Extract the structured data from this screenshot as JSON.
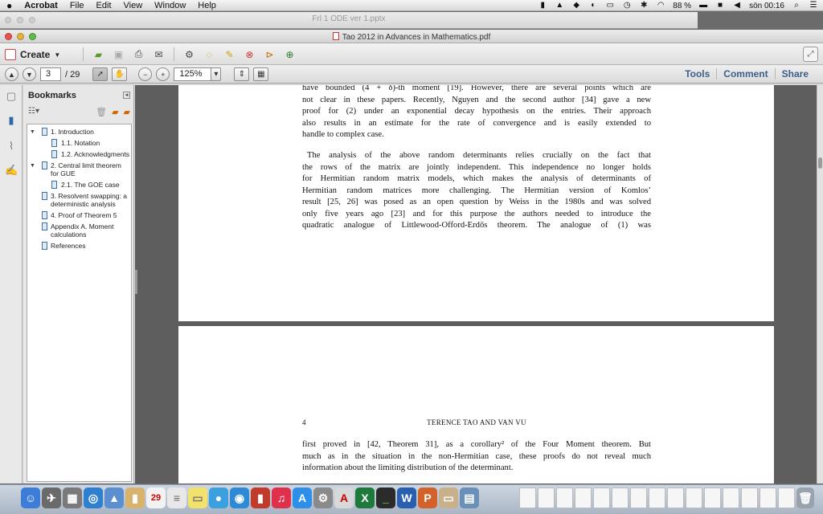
{
  "menubar": {
    "apple": "",
    "app": "Acrobat",
    "items": [
      "File",
      "Edit",
      "View",
      "Window",
      "Help"
    ],
    "battery": "88 %",
    "clock": "sön 00:16"
  },
  "background_window": {
    "title": "Frl 1 ODE ver 1.pptx"
  },
  "window": {
    "title": "Tao 2012 in Advances in Mathematics.pdf"
  },
  "toolbar": {
    "create_label": "Create"
  },
  "nav": {
    "current_page": "3",
    "total_pages": "/ 29",
    "zoom": "125%",
    "tools_label": "Tools",
    "comment_label": "Comment",
    "share_label": "Share"
  },
  "bookmarks": {
    "title": "Bookmarks",
    "items": [
      {
        "label": "1. Introduction"
      },
      {
        "label": "1.1. Notation"
      },
      {
        "label": "1.2. Acknowledgments"
      },
      {
        "label": "2. Central limit theorem for GUE"
      },
      {
        "label": "2.1. The GOE case"
      },
      {
        "label": "3. Resolvent swapping: a deterministic analysis"
      },
      {
        "label": "4. Proof of Theorem 5"
      },
      {
        "label": "Appendix A. Moment calculations"
      },
      {
        "label": "References"
      }
    ]
  },
  "page1": {
    "para1": [
      "have bounded (4 + δ)-th moment [19]. However, there are several points which are",
      "not clear in these papers. Recently, Nguyen and the second author [34] gave a new",
      "proof for (2) under an exponential decay hypothesis on the entries. Their approach",
      "also results in an estimate for the rate of convergence and is easily extended to",
      "handle to complex case."
    ],
    "para2": [
      "The analysis of the above random determinants relies crucially on the fact that",
      "the rows of the matrix are jointly independent. This independence no longer holds",
      "for Hermitian random matrix models, which makes the analysis of determinants of",
      "Hermitian random matrices more challenging. The Hermitian version of Komlos’",
      "result [25, 26] was posed as an open question by Weiss in the 1980s and was solved",
      "only five years ago [23] and for this purpose the authors needed to introduce the",
      "quadratic analogue of Littlewood-Offord-Erdős theorem. The analogue of (1) was"
    ]
  },
  "page2": {
    "page_number": "4",
    "running_head": "TERENCE TAO AND VAN VU",
    "para1": [
      "first proved in [42, Theorem 31], as a corollary² of the Four Moment theorem. But",
      "much as in the situation in the non-Hermitian case, these proofs do not reveal much",
      "information about the limiting distribution of the determinant."
    ]
  },
  "dock": {
    "calendar_day": "29"
  }
}
